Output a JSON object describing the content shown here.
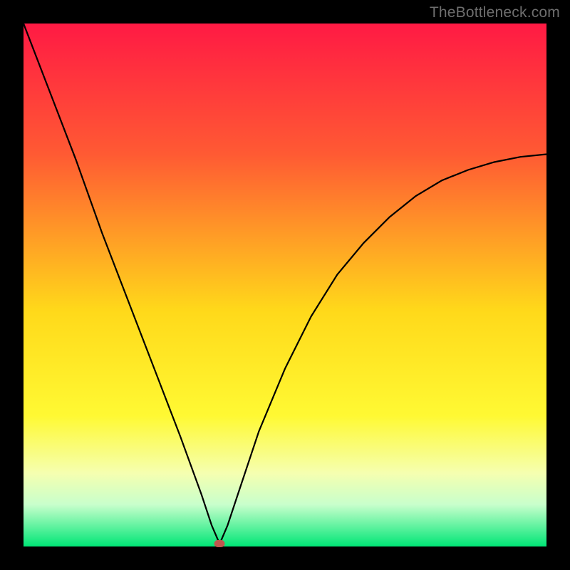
{
  "chart_data": {
    "type": "line",
    "attribution": "TheBottleneck.com",
    "title": "",
    "xlabel": "",
    "ylabel": "",
    "xlim": [
      0,
      1
    ],
    "ylim": [
      0,
      1
    ],
    "gradient_stops": [
      {
        "pos": 0.0,
        "color": "#ff1a44"
      },
      {
        "pos": 0.25,
        "color": "#ff5a33"
      },
      {
        "pos": 0.55,
        "color": "#ffd91a"
      },
      {
        "pos": 0.75,
        "color": "#fff933"
      },
      {
        "pos": 0.86,
        "color": "#f5ffb0"
      },
      {
        "pos": 0.92,
        "color": "#c8ffcc"
      },
      {
        "pos": 1.0,
        "color": "#00e676"
      }
    ],
    "curve": {
      "description": "V-shaped bottleneck curve with minimum around x≈0.37",
      "x": [
        0.0,
        0.05,
        0.1,
        0.15,
        0.2,
        0.25,
        0.3,
        0.34,
        0.36,
        0.375,
        0.39,
        0.41,
        0.45,
        0.5,
        0.55,
        0.6,
        0.65,
        0.7,
        0.75,
        0.8,
        0.85,
        0.9,
        0.95,
        1.0
      ],
      "y": [
        1.0,
        0.87,
        0.74,
        0.6,
        0.47,
        0.34,
        0.21,
        0.1,
        0.04,
        0.005,
        0.04,
        0.1,
        0.22,
        0.34,
        0.44,
        0.52,
        0.58,
        0.63,
        0.67,
        0.7,
        0.72,
        0.735,
        0.745,
        0.75
      ]
    },
    "optimal_point": {
      "x": 0.375,
      "y": 0.005
    },
    "colors": {
      "curve": "#000000",
      "marker": "#c0574f",
      "frame": "#000000"
    }
  },
  "curve_path": "",
  "marker_px": {
    "left": 0,
    "top": 0
  }
}
